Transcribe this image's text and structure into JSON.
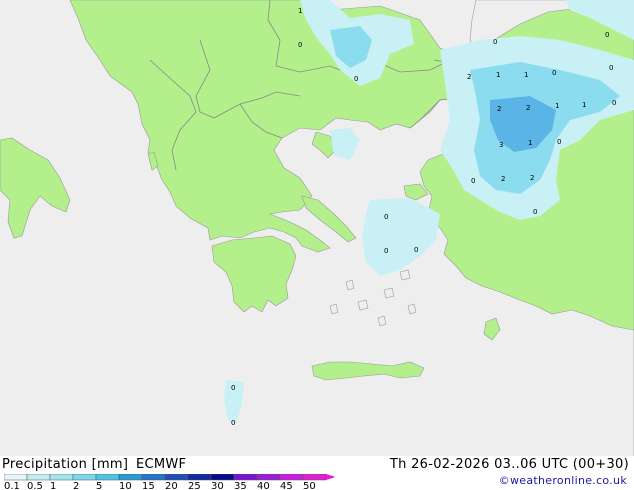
{
  "footer": {
    "title": "Precipitation [mm]",
    "model": "ECMWF",
    "valid": "Th 26-02-2026 03..06 UTC (00+30)",
    "credit": "©weatheronline.co.uk"
  },
  "legend": {
    "ticks": [
      "0.1",
      "0.5",
      "1",
      "2",
      "5",
      "10",
      "15",
      "20",
      "25",
      "30",
      "35",
      "40",
      "45",
      "50"
    ],
    "colors": [
      "#e6f5fa",
      "#c3edf5",
      "#a0e5f0",
      "#7dd8eb",
      "#4ec3e6",
      "#2a9ad2",
      "#2673c8",
      "#2050b4",
      "#102aa0",
      "#0a0a8c",
      "#7a14d2",
      "#9a1ed8",
      "#c81ee0",
      "#e11ed2"
    ]
  },
  "colors": {
    "sea": "#eeeeee",
    "land": "#b3f08c",
    "border": "#888888",
    "coast": "#999999",
    "precip_light": "#c8f0f5",
    "precip_med": "#8cdcf0",
    "precip_heavy": "#5ab4e6"
  },
  "map": {
    "values": [
      "1",
      "0",
      "0",
      "0",
      "0",
      "2",
      "1",
      "1",
      "0",
      "0",
      "2",
      "2",
      "1",
      "1",
      "0",
      "3",
      "1",
      "0",
      "2",
      "2",
      "0",
      "0",
      "0",
      "0",
      "0",
      "0",
      "0"
    ]
  }
}
